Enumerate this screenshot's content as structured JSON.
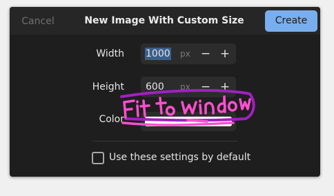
{
  "dialog": {
    "title": "New Image With Custom Size",
    "cancel_label": "Cancel",
    "create_label": "Create"
  },
  "width": {
    "label": "Width",
    "value": "1000",
    "unit": "px",
    "minus": "−",
    "plus": "+"
  },
  "height": {
    "label": "Height",
    "value": "600",
    "unit": "px",
    "minus": "−",
    "plus": "+"
  },
  "color": {
    "label": "Color",
    "swatch_color": "#ffffff"
  },
  "default_setting": {
    "label": "Use these settings by default",
    "checked": false
  },
  "annotation": {
    "text": "Fit to window",
    "ink_color": "#ff4fd0",
    "outline_color": "#a020c0"
  },
  "colors": {
    "accent": "#78aeed",
    "dialog_background": "#1e1e1e"
  }
}
